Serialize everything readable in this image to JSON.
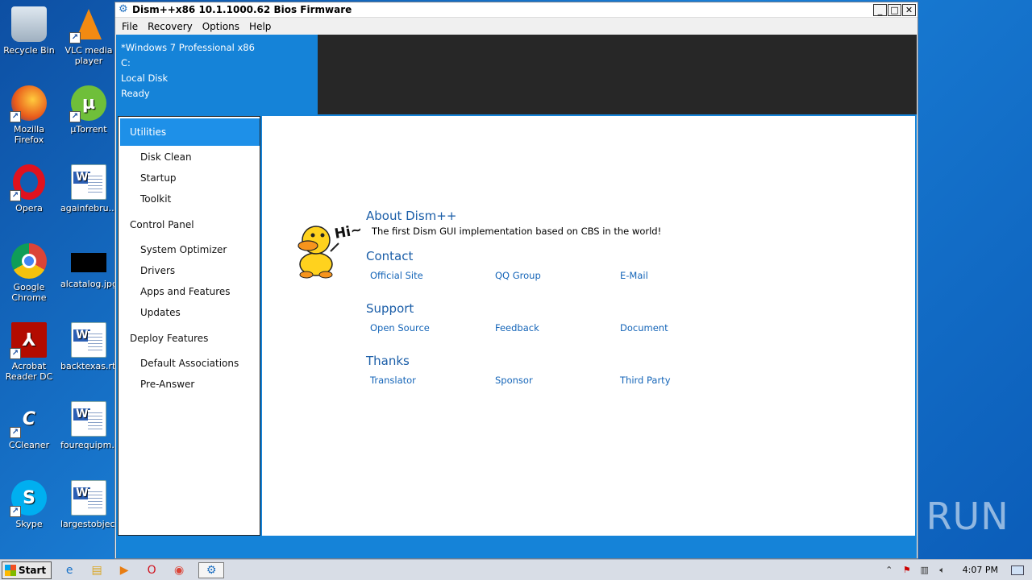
{
  "desktop": {
    "icons": [
      {
        "label": "Recycle Bin",
        "icon": "recycle-bin-icon"
      },
      {
        "label": "VLC media player",
        "icon": "vlc-icon"
      },
      {
        "label": "Mozilla Firefox",
        "icon": "firefox-icon"
      },
      {
        "label": "µTorrent",
        "icon": "utorrent-icon"
      },
      {
        "label": "Opera",
        "icon": "opera-icon"
      },
      {
        "label": "againfebru...",
        "icon": "word-doc-icon"
      },
      {
        "label": "Google Chrome",
        "icon": "chrome-icon"
      },
      {
        "label": "alcatalog.jpg",
        "icon": "image-file-icon"
      },
      {
        "label": "Acrobat Reader DC",
        "icon": "acrobat-icon"
      },
      {
        "label": "backtexas.rtf",
        "icon": "word-doc-icon"
      },
      {
        "label": "CCleaner",
        "icon": "ccleaner-icon"
      },
      {
        "label": "fourequipm...",
        "icon": "word-doc-icon"
      },
      {
        "label": "Skype",
        "icon": "skype-icon"
      },
      {
        "label": "largestobjec...",
        "icon": "word-doc-icon"
      }
    ]
  },
  "window": {
    "title": "Dism++x86 10.1.1000.62 Bios Firmware",
    "controls": {
      "minimize": "_",
      "maximize": "□",
      "close": "✕"
    },
    "menu": [
      "File",
      "Recovery",
      "Options",
      "Help"
    ],
    "info": {
      "os": "*Windows 7 Professional x86",
      "drive": "C:",
      "disk": "Local Disk",
      "status": "Ready"
    },
    "sidebar": {
      "utilities": "Utilities",
      "disk_clean": "Disk Clean",
      "startup": "Startup",
      "toolkit": "Toolkit",
      "control_panel": "Control Panel",
      "system_optimizer": "System Optimizer",
      "drivers": "Drivers",
      "apps_features": "Apps and Features",
      "updates": "Updates",
      "deploy_features": "Deploy Features",
      "default_associations": "Default Associations",
      "pre_answer": "Pre-Answer"
    },
    "about": {
      "title": "About Dism++",
      "subtitle": "The first Dism GUI implementation based on CBS in the world!",
      "hi": "Hi~",
      "contact": {
        "title": "Contact",
        "links": [
          "Official Site",
          "QQ Group",
          "E-Mail"
        ]
      },
      "support": {
        "title": "Support",
        "links": [
          "Open Source",
          "Feedback",
          "Document"
        ]
      },
      "thanks": {
        "title": "Thanks",
        "links": [
          "Translator",
          "Sponsor",
          "Third Party"
        ]
      }
    }
  },
  "watermark": "ANY RUN",
  "taskbar": {
    "start": "Start",
    "clock": "4:07 PM"
  },
  "colors": {
    "accent": "#1583d8",
    "sidebar_active": "#1e90e8",
    "link": "#1565b8",
    "section_title": "#1b5ea8"
  }
}
